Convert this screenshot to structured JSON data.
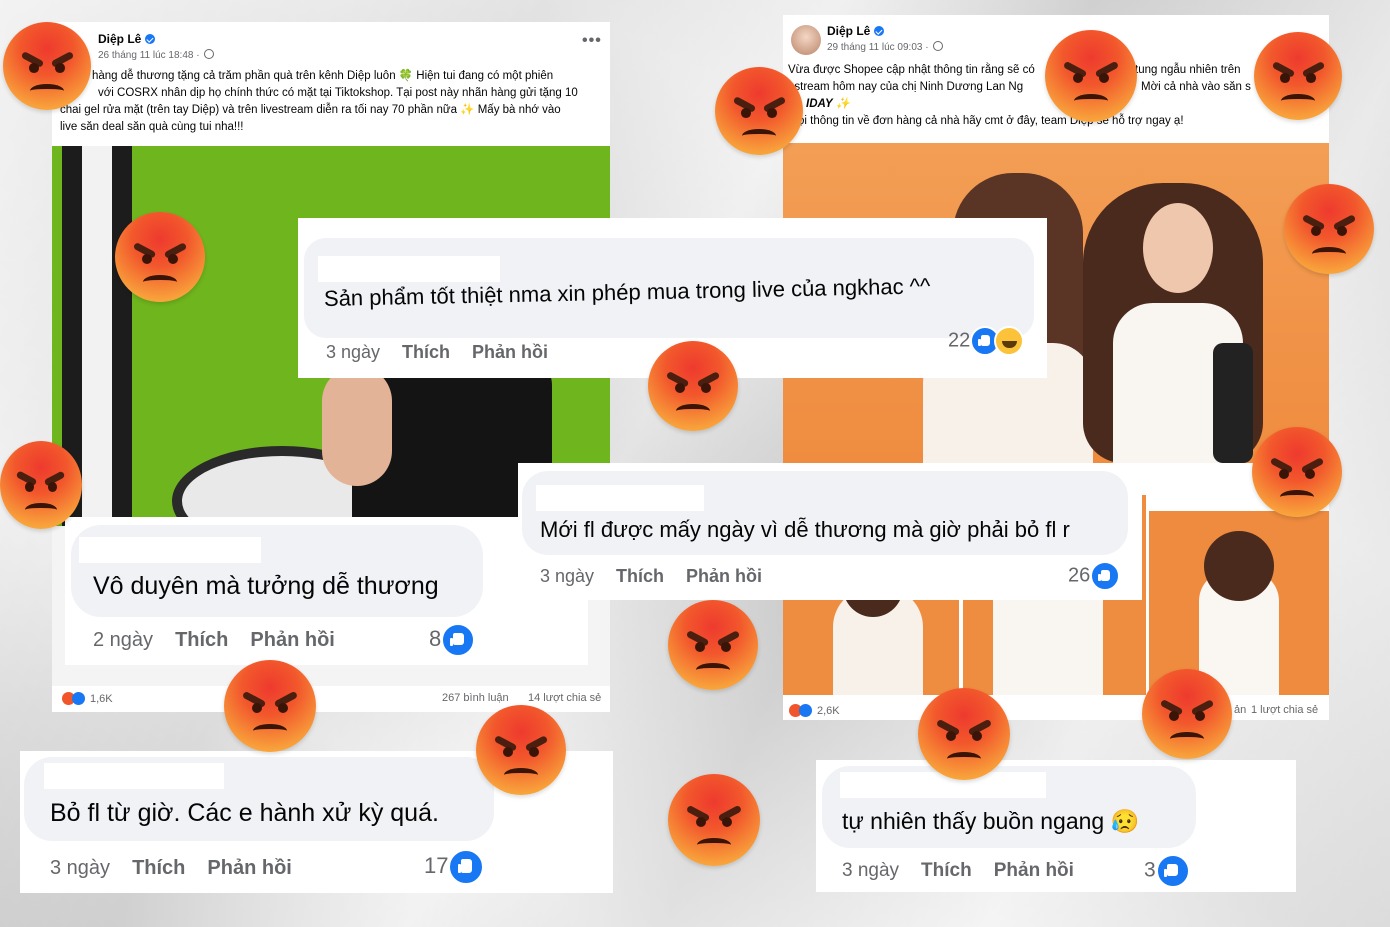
{
  "post_left": {
    "author": "Diệp Lê",
    "timestamp": "26 tháng 11 lúc 18:48 ·",
    "more": "•••",
    "caption_lines": [
      "hàng dễ thương tặng cả trăm phần quà trên kênh Diệp luôn 🍀 Hiện tui đang có một phiên",
      "với COSRX nhân dịp họ chính thức có mặt tại Tiktokshop. Tại post này nhãn hàng gửi tặng 10",
      "chai gel rửa mặt (trên tay Diệp) và trên livestream diễn ra tối nay 70 phần nữa ✨ Mấy bà nhớ vào",
      "live săn deal săn quà cùng tui nha!!!"
    ],
    "reaction_count": "1,6K",
    "comments_count": "267 bình luận",
    "shares_count": "14 lượt chia sẻ"
  },
  "post_right": {
    "author": "Diệp Lê",
    "timestamp": "29 tháng 11 lúc 09:03 ·",
    "caption_lines": [
      "Vừa được Shopee cập nhật thông tin rằng sẽ có",
      "estream hôm nay của chị Ninh Dương Lan Ng",
      "IDAY ✨",
      "ọi thông tin về đơn hàng cả nhà hãy cmt ở đây, team Diệp sẽ hỗ trợ ngay ạ!"
    ],
    "caption_right_lines": [
      "tung ngẫu nhiên trên",
      "Mời cả nhà vào săn s"
    ],
    "reaction_count": "2,6K",
    "shares_fragment": "ản",
    "shares_count": "1 lượt chia sẻ"
  },
  "comments": [
    {
      "text": "Sản phẩm tốt thiệt nma xin phép mua trong live của ngkhac ^^",
      "age": "3 ngày",
      "like": "Thích",
      "reply": "Phản hồi",
      "count": "22"
    },
    {
      "text": "Vô duyên mà tưởng dễ thương",
      "age": "2 ngày",
      "like": "Thích",
      "reply": "Phản hồi",
      "count": "8"
    },
    {
      "text": "Mới fl được mấy ngày vì dễ thương mà giờ phải bỏ fl r",
      "age": "3 ngày",
      "like": "Thích",
      "reply": "Phản hồi",
      "count": "26"
    },
    {
      "text": "Bỏ fl từ giờ. Các e hành xử kỳ quá.",
      "age": "3 ngày",
      "like": "Thích",
      "reply": "Phản hồi",
      "count": "17"
    },
    {
      "text": "tự nhiên thấy buồn ngang 😥",
      "age": "3 ngày",
      "like": "Thích",
      "reply": "Phản hồi",
      "count": "3"
    }
  ],
  "colors": {
    "fb_blue": "#1877f2",
    "bubble_bg": "#f0f2f5",
    "green_screen": "#74b81f",
    "orange_bg": "#f2924a",
    "angry_red": "#ee3a2e",
    "angry_yellow": "#fbbd45"
  },
  "icons": [
    "verified-badge-icon",
    "globe-icon",
    "like-reaction-icon",
    "haha-reaction-icon",
    "angry-emoji-icon",
    "more-options-icon"
  ]
}
